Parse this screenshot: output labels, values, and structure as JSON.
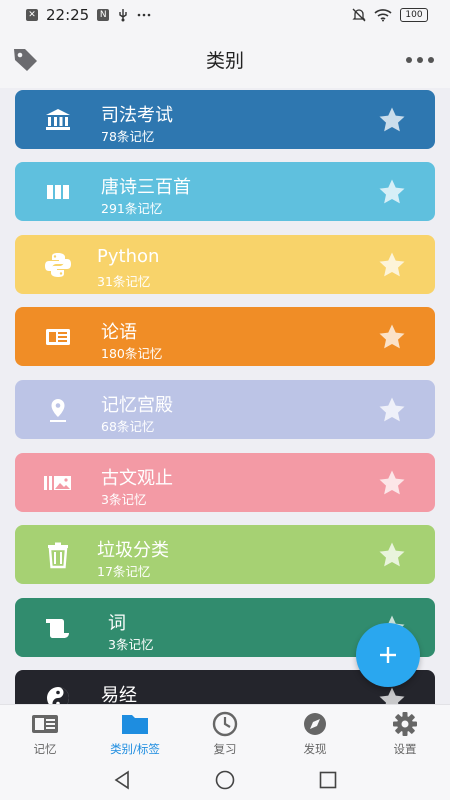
{
  "status_bar": {
    "time": "22:25",
    "left_icons": [
      "close-box-icon",
      "nfc-icon",
      "usb-icon",
      "more-dots"
    ],
    "right_icons": [
      "mute-icon",
      "wifi-icon"
    ],
    "battery": "100"
  },
  "header": {
    "title": "类别",
    "left_icon": "tag-icon",
    "right_icon": "more-dots-icon"
  },
  "categories": [
    {
      "title": "司法考试",
      "count": "78条记忆",
      "color": "#2e77b0",
      "icon": "bank-icon",
      "starred": true
    },
    {
      "title": "唐诗三百首",
      "count": "291条记忆",
      "color": "#5fc0de",
      "icon": "columns-icon",
      "starred": true
    },
    {
      "title": "Python",
      "count": "31条记忆",
      "color": "#f8d36a",
      "icon": "python-icon",
      "starred": true
    },
    {
      "title": "论语",
      "count": "180条记忆",
      "color": "#f08d26",
      "icon": "newspaper-icon",
      "starred": true
    },
    {
      "title": "记忆宫殿",
      "count": "68条记忆",
      "color": "#bcc4e6",
      "icon": "map-pin-icon",
      "starred": true
    },
    {
      "title": "古文观止",
      "count": "3条记忆",
      "color": "#f39aa5",
      "icon": "gallery-icon",
      "starred": true
    },
    {
      "title": "垃圾分类",
      "count": "17条记忆",
      "color": "#a6d173",
      "icon": "trash-icon",
      "starred": true
    },
    {
      "title": "词",
      "count": "3条记忆",
      "color": "#318c6e",
      "icon": "scroll-icon",
      "starred": true
    },
    {
      "title": "易经",
      "count": "",
      "color": "#24252c",
      "icon": "yin-yang-icon",
      "starred": true
    }
  ],
  "fab": {
    "icon": "plus-icon",
    "color": "#2aa7ef"
  },
  "bottom_nav": [
    {
      "label": "记忆",
      "icon": "card-icon",
      "active": false
    },
    {
      "label": "类别/标签",
      "icon": "folder-icon",
      "active": true
    },
    {
      "label": "复习",
      "icon": "clock-icon",
      "active": false
    },
    {
      "label": "发现",
      "icon": "compass-icon",
      "active": false
    },
    {
      "label": "设置",
      "icon": "gear-icon",
      "active": false
    }
  ],
  "system_nav": [
    "back-icon",
    "home-icon",
    "recents-icon"
  ],
  "colors": {
    "accent": "#1e8de0",
    "star": "rgba(255,255,255,0.75)"
  }
}
